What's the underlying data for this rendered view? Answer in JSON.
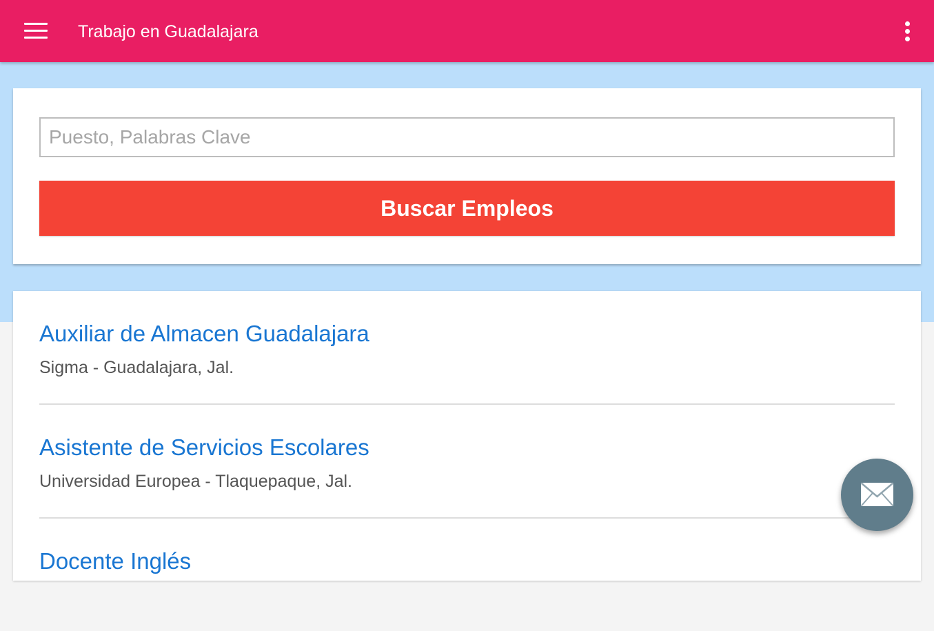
{
  "appbar": {
    "title": "Trabajo en Guadalajara",
    "menu_icon": "hamburger-menu-icon",
    "overflow_icon": "more-vert-icon",
    "color": "#e91e63"
  },
  "search": {
    "placeholder": "Puesto, Palabras Clave",
    "value": "",
    "button_label": "Buscar Empleos",
    "button_color": "#f44336"
  },
  "jobs": [
    {
      "title": "Auxiliar de Almacen Guadalajara",
      "meta": "Sigma - Guadalajara, Jal."
    },
    {
      "title": "Asistente de Servicios Escolares",
      "meta": "Universidad Europea - Tlaquepaque, Jal."
    },
    {
      "title": "Docente Inglés",
      "meta": ""
    }
  ],
  "fab": {
    "icon": "mail-icon",
    "color": "#607d8b"
  },
  "colors": {
    "background_band": "#bbdefb",
    "link": "#1976d2"
  }
}
